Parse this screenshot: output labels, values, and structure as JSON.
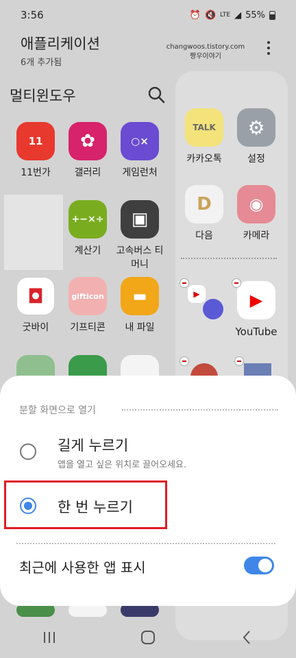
{
  "status": {
    "time": "3:56",
    "signal": "LTE",
    "battery": "55%"
  },
  "header": {
    "title": "애플리케이션",
    "subtitle": "6개 추가됨",
    "watermark_line1": "changwoos.tistory.com",
    "watermark_line2": "짱우이야기"
  },
  "multiwindow": {
    "title": "멀티윈도우"
  },
  "apps": [
    {
      "label": "11번가",
      "icon_text": "11",
      "color": "#e8392f",
      "icon": "11st-icon"
    },
    {
      "label": "갤러리",
      "icon_text": "✿",
      "color": "#d6236b",
      "icon": "gallery-icon"
    },
    {
      "label": "게임런처",
      "icon_text": "○×",
      "color": "#6a4bd1",
      "icon": "game-launcher-icon"
    },
    {
      "label": "계산기",
      "icon_text": "+−×÷",
      "color": "#79ad1f",
      "icon": "calculator-icon"
    },
    {
      "label": "고속버스 티머니",
      "icon_text": "▣",
      "color": "#3f3f3f",
      "icon": "express-bus-icon"
    },
    {
      "label": "굿바이",
      "icon_text": "◘",
      "color": "#d9232c",
      "icon": "goodbye-icon"
    },
    {
      "label": "기프티콘",
      "icon_text": "gifticon",
      "color": "#f2b1b0",
      "icon": "gifticon-icon"
    },
    {
      "label": "내 파일",
      "icon_text": "▬",
      "color": "#f2a718",
      "icon": "my-files-icon"
    }
  ],
  "right_apps": [
    {
      "label": "카카오톡",
      "icon_text": "TALK",
      "color": "#f3e37a",
      "icon": "kakaotalk-icon"
    },
    {
      "label": "설정",
      "icon_text": "⚙",
      "color": "#9aa0a8",
      "icon": "settings-icon"
    },
    {
      "label": "다음",
      "icon_text": "D",
      "color": "#f2f2f2",
      "icon": "daum-icon"
    },
    {
      "label": "카메라",
      "icon_text": "◉",
      "color": "#e68a96",
      "icon": "camera-icon"
    },
    {
      "label": "YouTube",
      "icon_text": "▶",
      "color": "#ffffff",
      "icon": "youtube-icon"
    }
  ],
  "sheet": {
    "section_title": "분할 화면으로 열기",
    "option1_label": "길게 누르기",
    "option1_desc": "앱을 열고 싶은 위치로 끌어오세요.",
    "option2_label": "한 번 누르기",
    "selected_option": "한 번 누르기",
    "recent_label": "최근에 사용한 앱 표시",
    "recent_toggle": "on"
  }
}
